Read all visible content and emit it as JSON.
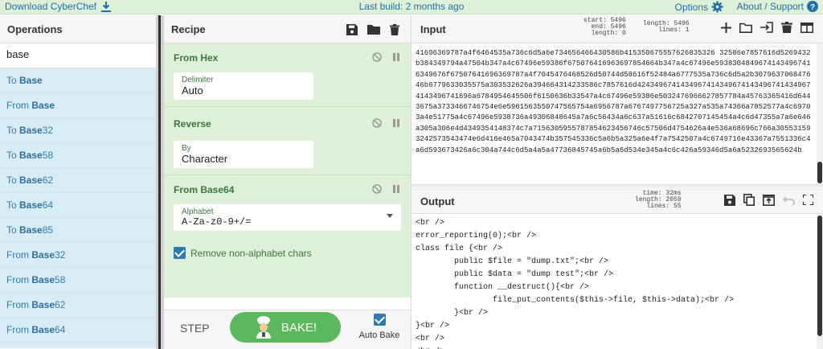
{
  "banner": {
    "download": "Download CyberChef",
    "last_build": "Last build: 2 months ago",
    "options": "Options",
    "about": "About / Support"
  },
  "operations": {
    "title": "Operations",
    "search_value": "base",
    "items": [
      {
        "prefix": "To ",
        "bold": "Base",
        "suffix": ""
      },
      {
        "prefix": "From ",
        "bold": "Base",
        "suffix": ""
      },
      {
        "prefix": "To ",
        "bold": "Base",
        "suffix": "32"
      },
      {
        "prefix": "To ",
        "bold": "Base",
        "suffix": "58"
      },
      {
        "prefix": "To ",
        "bold": "Base",
        "suffix": "62"
      },
      {
        "prefix": "To ",
        "bold": "Base",
        "suffix": "64"
      },
      {
        "prefix": "To ",
        "bold": "Base",
        "suffix": "85"
      },
      {
        "prefix": "From ",
        "bold": "Base",
        "suffix": "32"
      },
      {
        "prefix": "From ",
        "bold": "Base",
        "suffix": "58"
      },
      {
        "prefix": "From ",
        "bold": "Base",
        "suffix": "62"
      },
      {
        "prefix": "From ",
        "bold": "Base",
        "suffix": "64"
      }
    ]
  },
  "recipe": {
    "title": "Recipe",
    "ingredients": [
      {
        "name": "From Hex",
        "arg_label": "Delimiter",
        "arg_value": "Auto"
      },
      {
        "name": "Reverse",
        "arg_label": "By",
        "arg_value": "Character"
      },
      {
        "name": "From Base64",
        "arg_label": "Alphabet",
        "arg_value": "A-Za-z0-9+/=",
        "checkbox_label": "Remove non-alphabet chars"
      }
    ],
    "step_label": "STEP",
    "bake_label": "BAKE!",
    "auto_bake_label": "Auto Bake"
  },
  "input": {
    "title": "Input",
    "stats": {
      "start": "start: 5496",
      "end": "end: 5496",
      "length_sel": "length:    0",
      "length": "length: 5496",
      "lines": "lines:    1"
    },
    "text": "41696369787a4f6464535a736c6d5a6e734656466430586b415350675557626835326 32586e7857616d5269432b384349794a47504b347a4c67496e59386f675076416963697854664b347a4c67496e59383048496741434967416349676f67507641696369787a4f7045476468526d50744d58616f52484a6777535a736c6d5a2b307963706847646b6779633035575a303532626a394664314233586c7857616d42434967414349674143496741434967414349674143496741696a6784954645506f6150636b33547a4c67496e59386e5032476966627857784a45763365416d6443675a3733466746754e6e5961563550747565754a6956787a6767497756725a327a535a74366a7852577a4c69703a4e51775a4c67496e5938736a49306848645a7a6c56434a6c637a51616c6842707145454a4c6d47355a7a6e646a305a306e4d4349354148374c7a7156305955787854623456746c57506d4754626a4e536a68696c766a305531593242573543474e6d416e465a7043474b357545336c5a6b5a325a6e4f7a7542507a4c6749716e43367a7551336c4a6d593673426a6c304a744c6d5a4a5a47736845745a6b5a6d534e345a4c6c426a59346d5a6a5232693565624b"
  },
  "output": {
    "title": "Output",
    "stats": {
      "time": "time: 32ms",
      "length": "length: 2059",
      "lines": "lines:   55"
    },
    "lines": [
      "<br />",
      "error_reporting(0);<br />",
      "class file {<br />",
      "        public $file = \"dump.txt\";<br />",
      "        public $data = \"dump test\";<br />",
      "        function __destruct(){<br />",
      "                file_put_contents($this->file, $this->data);<br />",
      "        }<br />",
      "}<br />",
      "<br />",
      "<br />"
    ]
  },
  "colors": {
    "accent": "#2e7cb1",
    "bake_green": "#5cb85c",
    "recipe_bg": "#dff0d8",
    "ops_bg": "#d8ecf6"
  }
}
